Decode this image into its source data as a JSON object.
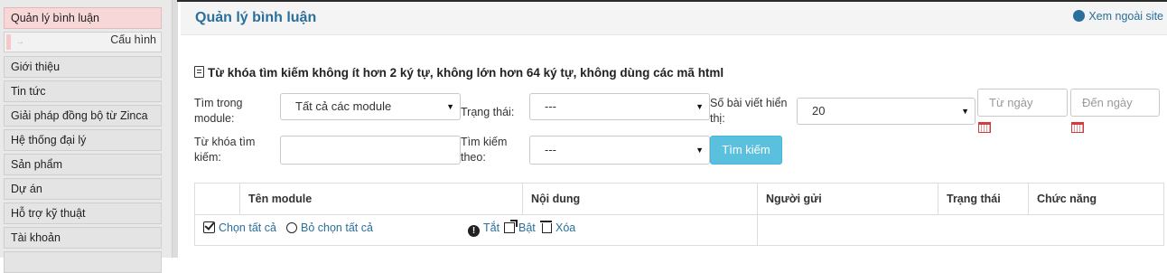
{
  "sidebar": {
    "items": [
      {
        "label": "Quản lý bình luận",
        "active": true
      },
      {
        "label": "Giới thiệu"
      },
      {
        "label": "Tin tức"
      },
      {
        "label": "Giải pháp đồng bộ từ Zinca"
      },
      {
        "label": "Hệ thống đại lý"
      },
      {
        "label": "Sản phẩm"
      },
      {
        "label": "Dự án"
      },
      {
        "label": "Hỗ trợ kỹ thuật"
      },
      {
        "label": "Tài khoản"
      }
    ],
    "sub_item": {
      "label": "Cấu hình"
    }
  },
  "header": {
    "title": "Quản lý bình luận",
    "site_link": "Xem ngoài site"
  },
  "filter": {
    "notice": "Từ khóa tìm kiếm không ít hơn 2 ký tự, không lớn hơn 64 ký tự, không dùng các mã html",
    "module_label_1": "Tìm trong",
    "module_label_2": "module:",
    "module_value": "Tất cả các module",
    "status_label": "Trạng thái:",
    "status_value": "---",
    "perpage_label_1": "Số bài viết hiển",
    "perpage_label_2": "thị:",
    "perpage_value": "20",
    "from_date_placeholder": "Từ ngày",
    "to_date_placeholder": "Đến ngày",
    "keyword_label_1": "Từ khóa tìm",
    "keyword_label_2": "kiếm:",
    "keyword_value": "",
    "searchby_label_1": "Tìm kiếm",
    "searchby_label_2": "theo:",
    "searchby_value": "---",
    "search_button": "Tìm kiếm"
  },
  "table": {
    "columns": [
      "Tên module",
      "Nội dung",
      "Người gửi",
      "Trạng thái",
      "Chức năng"
    ],
    "actions": {
      "select_all": "Chọn tất cả",
      "deselect_all": "Bỏ chọn tất cả",
      "off": "Tắt",
      "on": "Bật",
      "delete": "Xóa"
    }
  },
  "colors": {
    "accent": "#2a6f9b",
    "active_sidebar": "#f7d7d7",
    "search_button": "#5bc0de",
    "calendar": "#d23c3c"
  }
}
